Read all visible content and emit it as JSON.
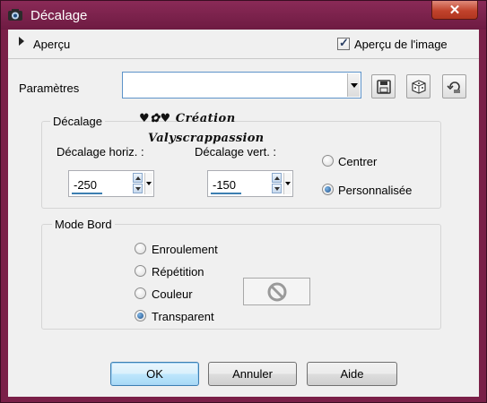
{
  "window": {
    "title": "Décalage",
    "close_symbol": "✕"
  },
  "preview": {
    "label": "Aperçu",
    "checkbox_label": "Aperçu de l'image",
    "checked": true
  },
  "params": {
    "label": "Paramètres",
    "value": ""
  },
  "offset_group": {
    "title": "Décalage",
    "watermark_line1": "♥✿♥ Création",
    "watermark_line2": "Valyscrappassion",
    "horiz_label": "Décalage horiz. :",
    "horiz_value": "-250",
    "vert_label": "Décalage vert. :",
    "vert_value": "-150",
    "radios": [
      {
        "label": "Centrer",
        "checked": false
      },
      {
        "label": "Personnalisée",
        "checked": true
      }
    ]
  },
  "edge_group": {
    "title": "Mode Bord",
    "radios": [
      {
        "label": "Enroulement",
        "checked": false
      },
      {
        "label": "Répétition",
        "checked": false
      },
      {
        "label": "Couleur",
        "checked": false
      },
      {
        "label": "Transparent",
        "checked": true
      }
    ]
  },
  "buttons": {
    "ok": "OK",
    "cancel": "Annuler",
    "help": "Aide"
  },
  "colors": {
    "title_bar": "#7a2048",
    "close_button": "#c1432c",
    "accent": "#3c7fb1"
  }
}
